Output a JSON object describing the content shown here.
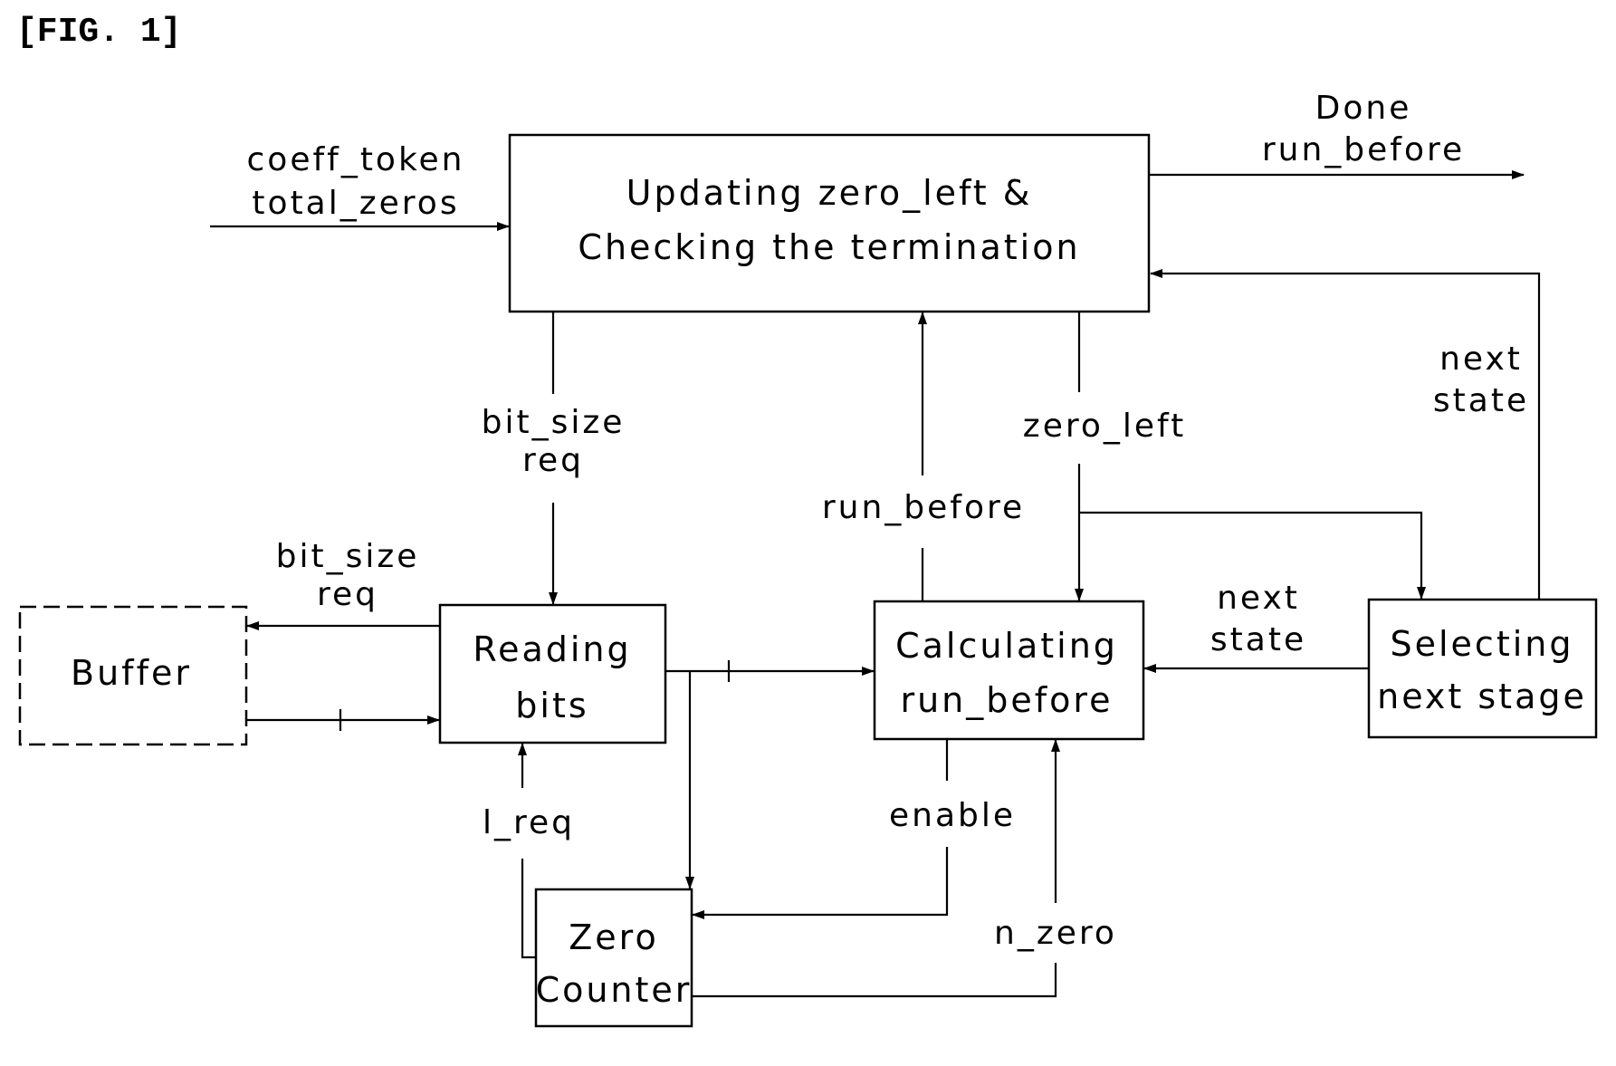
{
  "figure": {
    "title": "[FIG. 1]"
  },
  "blocks": {
    "update": {
      "line1": "Updating zero_left &",
      "line2": "Checking the termination"
    },
    "reading": {
      "line1": "Reading",
      "line2": "bits"
    },
    "buffer": {
      "line1": "Buffer"
    },
    "calculating": {
      "line1": "Calculating",
      "line2": "run_before"
    },
    "selecting": {
      "line1": "Selecting",
      "line2": "next stage"
    },
    "zero_counter": {
      "line1": "Zero",
      "line2": "Counter"
    }
  },
  "signals": {
    "input": {
      "line1": "coeff_token",
      "line2": "total_zeros"
    },
    "output": {
      "line1": "Done",
      "line2": "run_before"
    },
    "bitsize_to_reading": {
      "line1": "bit_size",
      "line2": "req"
    },
    "bitsize_to_buffer": {
      "line1": "bit_size",
      "line2": "req"
    },
    "run_before_up": {
      "line1": "run_before"
    },
    "zero_left": {
      "line1": "zero_left"
    },
    "next_state_top": {
      "line1": "next",
      "line2": "state"
    },
    "next_state_mid": {
      "line1": "next",
      "line2": "state"
    },
    "l_req": {
      "line1": "l_req"
    },
    "enable": {
      "line1": "enable"
    },
    "n_zero": {
      "line1": "n_zero"
    }
  },
  "colors": {
    "ink": "#000000",
    "paper": "#ffffff"
  }
}
